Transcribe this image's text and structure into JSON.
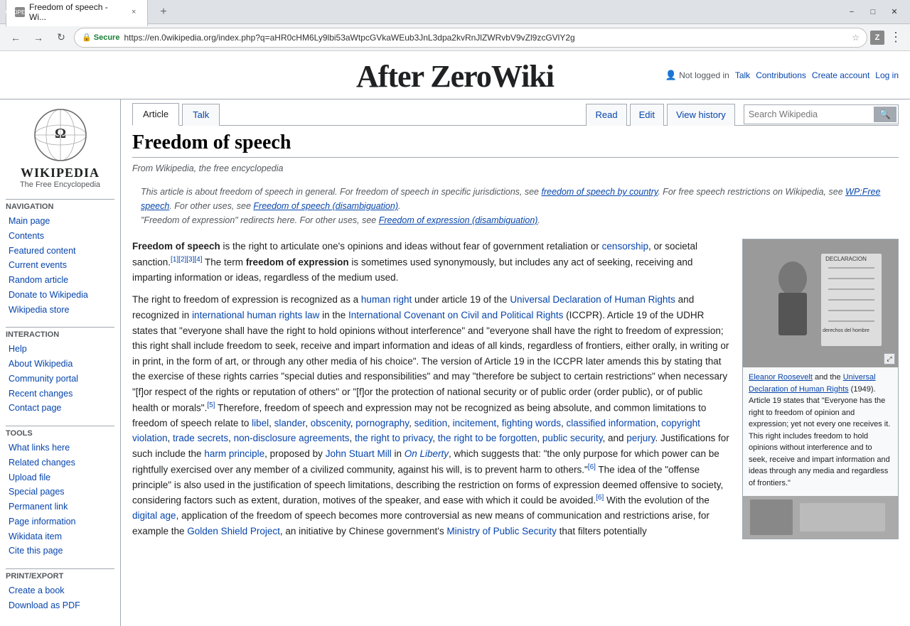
{
  "browser": {
    "tab_title": "Freedom of speech - Wi...",
    "tab_favicon": "W",
    "url_secure": "Secure",
    "url": "https://en.0wikipedia.org/index.php?q=aHR0cHM6Ly9lbi53aWtpcGVkaWEub3JnL3dpa2kvRnJlZWRvbV9vZl9zcGVlY2g",
    "window_controls": {
      "minimize": "−",
      "maximize": "□",
      "close": "✕"
    }
  },
  "wiki": {
    "site_name": "WIKIPEDIA",
    "site_tagline": "The Free Encyclopedia",
    "banner_title": "After ZeroWiki",
    "top_right": {
      "not_logged_in": "Not logged in",
      "talk": "Talk",
      "contributions": "Contributions",
      "create_account": "Create account",
      "log_in": "Log in"
    },
    "tabs": {
      "article": "Article",
      "talk": "Talk",
      "read": "Read",
      "edit": "Edit",
      "view_history": "View history"
    },
    "search_placeholder": "Search Wikipedia",
    "article": {
      "title": "Freedom of speech",
      "from_line": "From Wikipedia, the free encyclopedia",
      "hatnote_1": "This article is about freedom of speech in general. For freedom of speech in specific jurisdictions, see freedom of speech by country. For free speech restrictions on Wikipedia, see WP:Free speech. For other uses, see Freedom of speech (disambiguation).",
      "hatnote_2": "\"Freedom of expression\" redirects here. For other uses, see Freedom of expression (disambiguation).",
      "body_p1": "Freedom of speech is the right to articulate one's opinions and ideas without fear of government retaliation or censorship, or societal sanction.[1][2][3][4] The term freedom of expression is sometimes used synonymously, but includes any act of seeking, receiving and imparting information or ideas, regardless of the medium used.",
      "body_p2": "The right to freedom of expression is recognized as a human right under article 19 of the Universal Declaration of Human Rights and recognized in international human rights law in the International Covenant on Civil and Political Rights (ICCPR). Article 19 of the UDHR states that \"everyone shall have the right to hold opinions without interference\" and \"everyone shall have the right to freedom of expression; this right shall include freedom to seek, receive and impart information and ideas of all kinds, regardless of frontiers, either orally, in writing or in print, in the form of art, or through any other media of his choice\". The version of Article 19 in the ICCPR later amends this by stating that the exercise of these rights carries \"special duties and responsibilities\" and may \"therefore be subject to certain restrictions\" when necessary \"[f]or respect of the rights or reputation of others\" or \"[f]or the protection of national security or of public order (order public), or of public health or morals\".[5] Therefore, freedom of speech and expression may not be recognized as being absolute, and common limitations to freedom of speech relate to libel, slander, obscenity, pornography, sedition, incitement, fighting words, classified information, copyright violation, trade secrets, non-disclosure agreements, the right to privacy, the right to be forgotten, public security, and perjury. Justifications for such include the harm principle, proposed by John Stuart Mill in On Liberty, which suggests that: \"the only purpose for which power can be rightfully exercised over any member of a civilized community, against his will, is to prevent harm to others.\"[6] The idea of the \"offense principle\" is also used in the justification of speech limitations, describing the restriction on forms of expression deemed offensive to society, considering factors such as extent, duration, motives of the speaker, and ease with which it could be avoided.[6] With the evolution of the digital age, application of the freedom of speech becomes more controversial as new means of communication and restrictions arise, for example the Golden Shield Project, an initiative by Chinese government's Ministry of Public Security that filters potentially",
      "infobox_caption": "Eleanor Roosevelt and the Universal Declaration of Human Rights (1949). Article 19 states that \"Everyone has the right to freedom of opinion and expression; yet not every one receives it. This right includes freedom to hold opinions without interference and to seek, receive and impart information and ideas through any media and regardless of frontiers.\""
    },
    "sidebar": {
      "navigation_heading": "Navigation",
      "nav_links": [
        {
          "label": "Main page",
          "id": "main-page"
        },
        {
          "label": "Contents",
          "id": "contents"
        },
        {
          "label": "Featured content",
          "id": "featured-content"
        },
        {
          "label": "Current events",
          "id": "current-events"
        },
        {
          "label": "Random article",
          "id": "random-article"
        },
        {
          "label": "Donate to Wikipedia",
          "id": "donate"
        },
        {
          "label": "Wikipedia store",
          "id": "store"
        }
      ],
      "interaction_heading": "Interaction",
      "interaction_links": [
        {
          "label": "Help",
          "id": "help"
        },
        {
          "label": "About Wikipedia",
          "id": "about"
        },
        {
          "label": "Community portal",
          "id": "community-portal"
        },
        {
          "label": "Recent changes",
          "id": "recent-changes"
        },
        {
          "label": "Contact page",
          "id": "contact"
        }
      ],
      "tools_heading": "Tools",
      "tools_links": [
        {
          "label": "What links here",
          "id": "what-links"
        },
        {
          "label": "Related changes",
          "id": "related-changes"
        },
        {
          "label": "Upload file",
          "id": "upload-file"
        },
        {
          "label": "Special pages",
          "id": "special-pages"
        },
        {
          "label": "Permanent link",
          "id": "permanent-link"
        },
        {
          "label": "Page information",
          "id": "page-info"
        },
        {
          "label": "Wikidata item",
          "id": "wikidata"
        },
        {
          "label": "Cite this page",
          "id": "cite-this"
        }
      ],
      "print_heading": "Print/export",
      "print_links": [
        {
          "label": "Create a book",
          "id": "create-book"
        },
        {
          "label": "Download as PDF",
          "id": "download-pdf"
        }
      ]
    }
  }
}
